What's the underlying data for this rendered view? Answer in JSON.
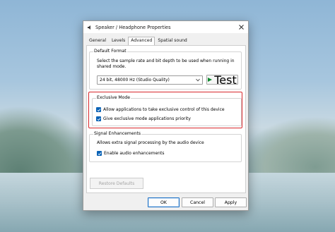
{
  "window": {
    "title": "Speaker / Headphone Properties",
    "close_icon": "close-icon",
    "title_icon": "speaker-icon"
  },
  "tabs": [
    {
      "label": "General"
    },
    {
      "label": "Levels"
    },
    {
      "label": "Advanced",
      "active": true
    },
    {
      "label": "Spatial sound"
    }
  ],
  "default_format": {
    "title": "Default Format",
    "description": "Select the sample rate and bit depth to be used when running in shared mode.",
    "selected_value": "24 bit, 48000 Hz (Studio Quality)",
    "test_label": "Test"
  },
  "exclusive_mode": {
    "title": "Exclusive Mode",
    "options": [
      {
        "label": "Allow applications to take exclusive control of this device",
        "checked": true
      },
      {
        "label": "Give exclusive mode applications priority",
        "checked": true
      }
    ]
  },
  "signal_enhancements": {
    "title": "Signal Enhancements",
    "description": "Allows extra signal processing by the audio device",
    "options": [
      {
        "label": "Enable audio enhancements",
        "checked": true
      }
    ]
  },
  "buttons": {
    "restore_defaults": "Restore Defaults",
    "ok": "OK",
    "cancel": "Cancel",
    "apply": "Apply"
  },
  "colors": {
    "highlight_box": "#d8272b",
    "checkbox_accent": "#0b63b6",
    "test_play": "#0f8a2d"
  }
}
